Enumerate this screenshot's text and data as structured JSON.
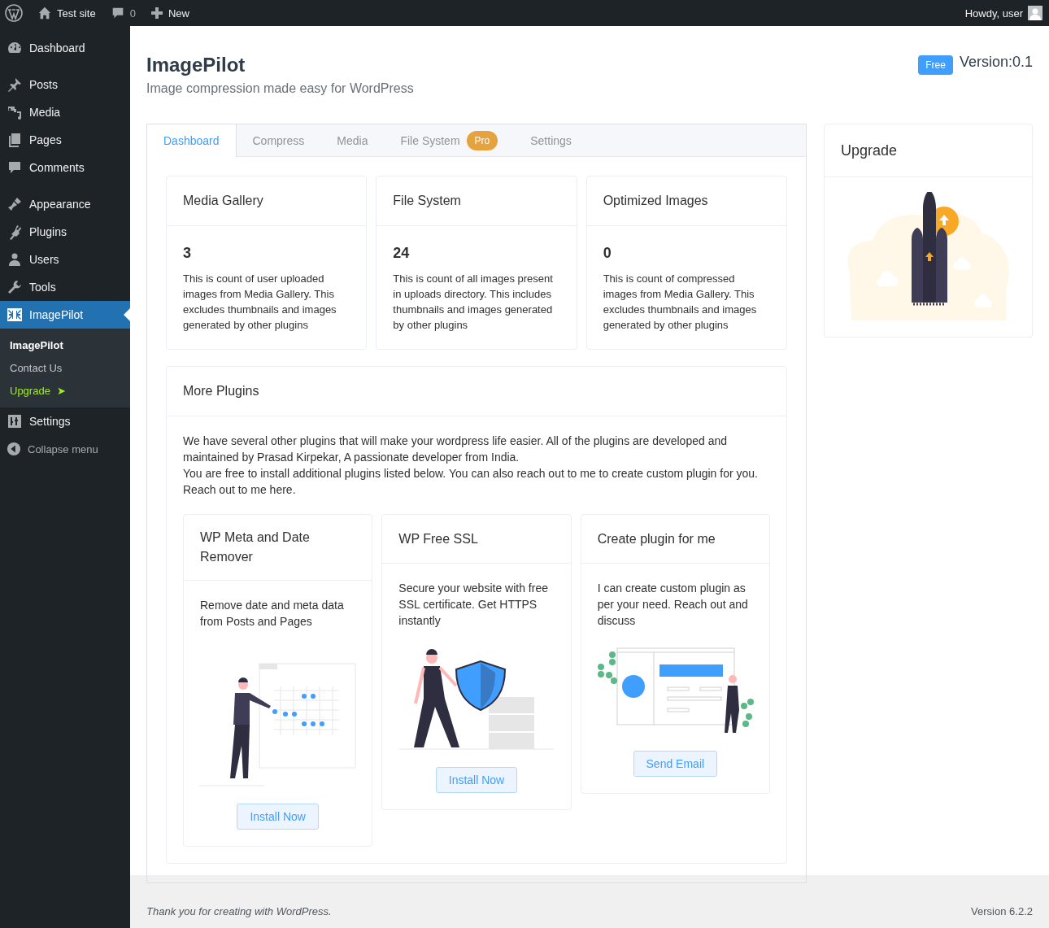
{
  "admin_bar": {
    "site": "Test site",
    "comments": "0",
    "new": "New",
    "greeting": "Howdy, user"
  },
  "sidebar": {
    "groups": [
      [
        {
          "label": "Dashboard",
          "selected": false
        }
      ],
      [
        {
          "label": "Posts",
          "selected": false
        },
        {
          "label": "Media",
          "selected": false
        },
        {
          "label": "Pages",
          "selected": false
        },
        {
          "label": "Comments",
          "selected": false
        }
      ],
      [
        {
          "label": "Appearance",
          "selected": false
        },
        {
          "label": "Plugins",
          "selected": false
        },
        {
          "label": "Users",
          "selected": false
        },
        {
          "label": "Tools",
          "selected": false
        },
        {
          "label": "ImagePilot",
          "selected": true,
          "submenu": [
            {
              "label": "ImagePilot",
              "selected": true,
              "kind": "plain"
            },
            {
              "label": "Contact Us",
              "selected": false,
              "kind": "plain"
            },
            {
              "label": "Upgrade",
              "selected": false,
              "kind": "highlight",
              "arrow": "➤"
            }
          ]
        },
        {
          "label": "Settings",
          "selected": false
        }
      ]
    ],
    "collapse": "Collapse menu"
  },
  "header": {
    "title": "ImagePilot",
    "subtitle": "Image compression made easy for WordPress",
    "badge": "Free",
    "version": "Version:0.1"
  },
  "tabs": [
    {
      "label": "Dashboard",
      "selected": true
    },
    {
      "label": "Compress",
      "selected": false
    },
    {
      "label": "Media",
      "selected": false
    },
    {
      "label": "File System",
      "selected": false,
      "badge": "Pro"
    },
    {
      "label": "Settings",
      "selected": false
    }
  ],
  "stats": [
    {
      "title": "Media Gallery",
      "count": "3",
      "description": "This is count of user uploaded images from Media Gallery. This excludes thumbnails and images generated by other plugins"
    },
    {
      "title": "File System",
      "count": "24",
      "description": "This is count of all images present in uploads directory. This includes thumbnails and images generated by other plugins"
    },
    {
      "title": "Optimized Images",
      "count": "0",
      "description": "This is count of compressed images from Media Gallery. This excludes thumbnails and images generated by other plugins"
    }
  ],
  "more_plugins": {
    "title": "More Plugins",
    "paragraphs": [
      "We have several other plugins that will make your wordpress life easier. All of the plugins are developed and maintained by Prasad Kirpekar, A passionate developer from India.",
      "You are free to install additional plugins listed below. You can also reach out to me to create custom plugin for you. Reach out to me here."
    ],
    "plugins": [
      {
        "title": "WP Meta and Date Remover",
        "description": "Remove date and meta data from Posts and Pages",
        "button": "Install Now"
      },
      {
        "title": "WP Free SSL",
        "description": "Secure your website with free SSL certificate. Get HTTPS instantly",
        "button": "Install Now"
      },
      {
        "title": "Create plugin for me",
        "description": "I can create custom plugin as per your need. Reach out and discuss",
        "button": "Send Email"
      }
    ]
  },
  "upgrade": {
    "title": "Upgrade"
  },
  "footer": {
    "thanks": "Thank you for creating with WordPress.",
    "version": "Version 6.2.2"
  }
}
